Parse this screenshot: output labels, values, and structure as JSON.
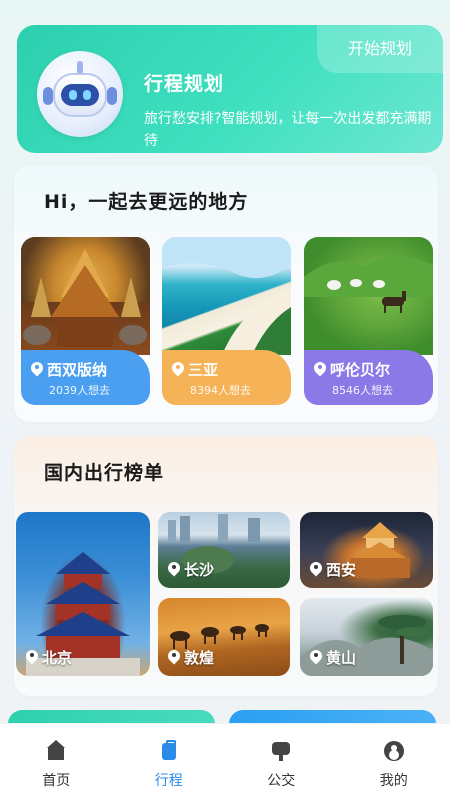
{
  "banner": {
    "title": "行程规划",
    "description": "旅行愁安排?智能规划，让每一次出发都充满期待",
    "start_label": "开始规划",
    "icon": "robot-icon"
  },
  "section_recommend": {
    "title": "Hi，一起去更远的地方",
    "items": [
      {
        "name": "西双版纳",
        "count": "2039人想去",
        "color": "#4a9ff0"
      },
      {
        "name": "三亚",
        "count": "8394人想去",
        "color": "#f5b257"
      },
      {
        "name": "呼伦贝尔",
        "count": "8546人想去",
        "color": "#8b79e8"
      }
    ]
  },
  "section_ranking": {
    "title": "国内出行榜单",
    "items": [
      {
        "name": "北京"
      },
      {
        "name": "长沙"
      },
      {
        "name": "西安"
      },
      {
        "name": "敦煌"
      },
      {
        "name": "黄山"
      }
    ]
  },
  "tabbar": {
    "items": [
      {
        "label": "首页",
        "icon": "home-icon"
      },
      {
        "label": "行程",
        "icon": "luggage-icon"
      },
      {
        "label": "公交",
        "icon": "bus-icon"
      },
      {
        "label": "我的",
        "icon": "user-icon"
      }
    ],
    "active_color": "#2a8be8"
  }
}
